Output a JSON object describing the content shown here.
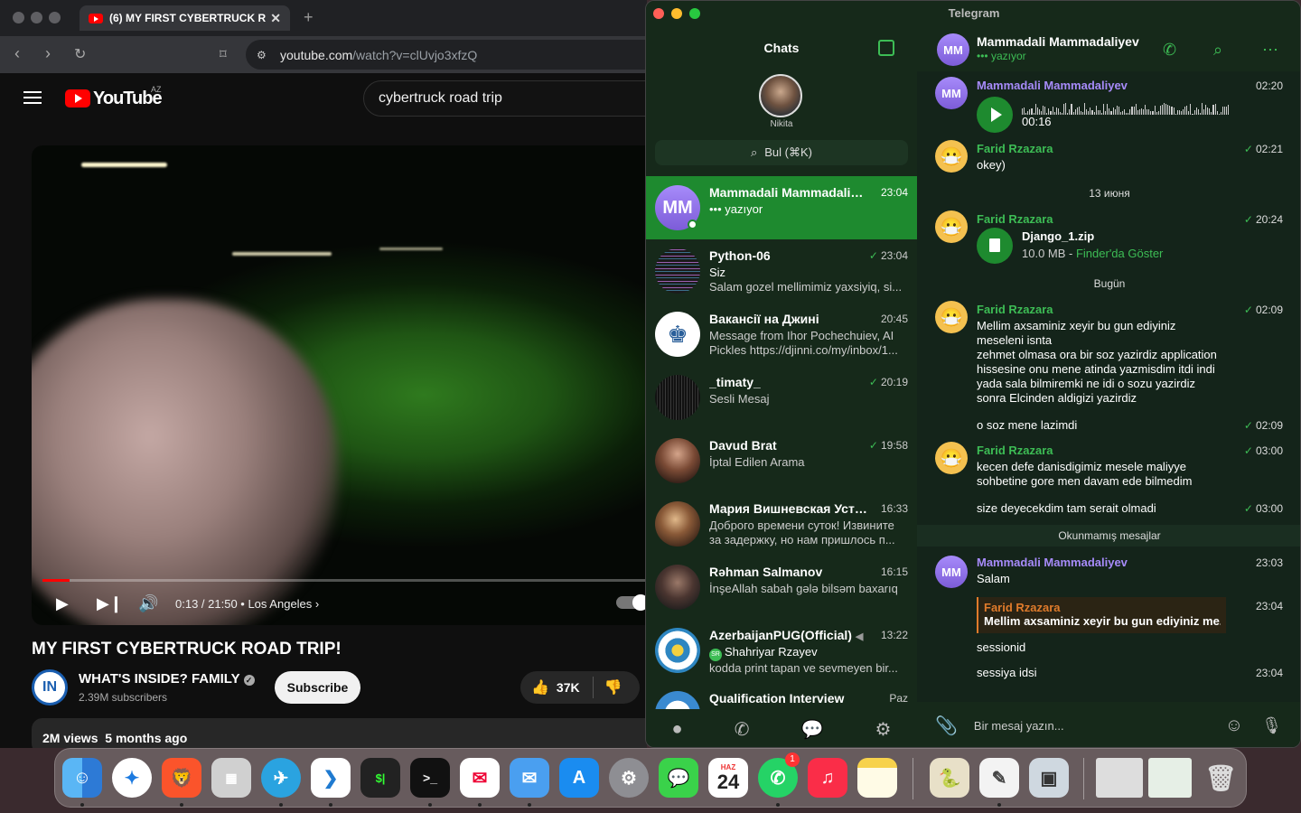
{
  "browser": {
    "tab_title": "(6) MY FIRST CYBERTRUCK R",
    "tab_close": "✕",
    "new_tab": "+",
    "url_host": "youtube.com",
    "url_path": "/watch?v=clUvjo3xfzQ"
  },
  "youtube": {
    "logo_text": "YouTube",
    "region": "AZ",
    "search_value": "cybertruck road trip",
    "player": {
      "time": "0:13 / 21:50",
      "chapter": "Los Angeles",
      "progress_fraction": 0.0099
    },
    "video_title": "MY FIRST CYBERTRUCK ROAD TRIP!",
    "channel_name": "WHAT'S INSIDE? FAMILY",
    "channel_avatar": "IN",
    "subscribers": "2.39M subscribers",
    "subscribe_label": "Subscribe",
    "likes": "37K",
    "views": "2M views",
    "age": "5 months ago"
  },
  "telegram": {
    "window_title": "Telegram",
    "chats_title": "Chats",
    "me_name": "Nikita",
    "search_placeholder": "Bul (⌘K)",
    "chats": [
      {
        "name": "Mammadali Mammadaliyev",
        "time": "23:04",
        "line1": "••• yazıyor",
        "line2": "",
        "avatar": "MM",
        "read": false
      },
      {
        "name": "Python-06",
        "time": "23:04",
        "line1": "Siz",
        "line2": "Salam gozel mellimimiz yaxsiyiq, si...",
        "read": true
      },
      {
        "name": "Вакансії на Джині",
        "time": "20:45",
        "line1": "Message from Ihor Pochechuiev, AI",
        "line2": "Pickles https://djinni.co/my/inbox/1...",
        "read": false
      },
      {
        "name": "_timaty_",
        "time": "20:19",
        "line1": "Sesli Mesaj",
        "line2": "",
        "read": true
      },
      {
        "name": "Davud Brat",
        "time": "19:58",
        "line1": "İptal Edilen Arama",
        "line2": "",
        "read": true
      },
      {
        "name": "Мария Вишневская Устр...",
        "time": "16:33",
        "line1": "Доброго времени суток! Извините",
        "line2": "за задержку, но нам пришлось п...",
        "read": false
      },
      {
        "name": "Rəhman Salmanov",
        "time": "16:15",
        "line1": "İnşeAllah sabah gələ bilsəm baxarıq",
        "line2": "",
        "read": false
      },
      {
        "name": "AzerbaijanPUG(Official)",
        "time": "13:22",
        "line1": "Shahriyar Rzayev",
        "line2": "kodda print tapan ve sevmeyen bir...",
        "sender_badge": "SR",
        "read": false
      },
      {
        "name": "Qualification Interview",
        "time": "Paz",
        "line1": "",
        "line2": "",
        "read": false
      }
    ],
    "header": {
      "name": "Mammadali Mammadaliyev",
      "status": "yazıyor",
      "avatar": "MM"
    },
    "messages": {
      "m1_sender": "Mammadali Mammadaliyev",
      "m1_time": "02:20",
      "m1_duration": "00:16",
      "m2_sender": "Farid Rzazara",
      "m2_text": "okey)",
      "m2_time": "02:21",
      "date1": "13 июня",
      "m3_sender": "Farid Rzazara",
      "m3_file": "Django_1.zip",
      "m3_size": "10.0 MB - ",
      "m3_link": "Finder'da Göster",
      "m3_time": "20:24",
      "date2": "Bugün",
      "m4_sender": "Farid Rzazara",
      "m4_time": "02:09",
      "m4_lines": [
        "Mellim axsaminiz xeyir bu gun ediyiniz",
        "meseleni isnta",
        "zehmet olmasa ora bir soz yazirdiz application",
        "hissesine onu mene atinda yazmisdim itdi indi",
        "yada sala bilmiremki ne idi o sozu yazirdiz",
        "sonra Elcinden aldigizi yazirdiz"
      ],
      "m5_text": "o soz mene lazimdi",
      "m5_time": "02:09",
      "m6_sender": "Farid Rzazara",
      "m6_time": "03:00",
      "m6_lines": [
        "kecen defe danisdigimiz mesele maliyye",
        "sohbetine gore men davam ede bilmedim"
      ],
      "m7_text": "size deyecekdim tam serait olmadi",
      "m7_time": "03:00",
      "unread": "Okunmamış mesajlar",
      "m8_sender": "Mammadali Mammadaliyev",
      "m8_text": "Salam",
      "m8_time": "23:03",
      "m9_reply_name": "Farid Rzazara",
      "m9_reply_text": "Mellim axsaminiz xeyir bu gun ediyiniz me...",
      "m9_time": "23:04",
      "m10_text": "sessionid",
      "m11_text": "sessiya idsi",
      "m11_time": "23:04"
    },
    "composer_placeholder": "Bir mesaj yazın..."
  },
  "dock": {
    "calendar_month": "HAZ",
    "calendar_day": "24",
    "whatsapp_badge": "1"
  }
}
